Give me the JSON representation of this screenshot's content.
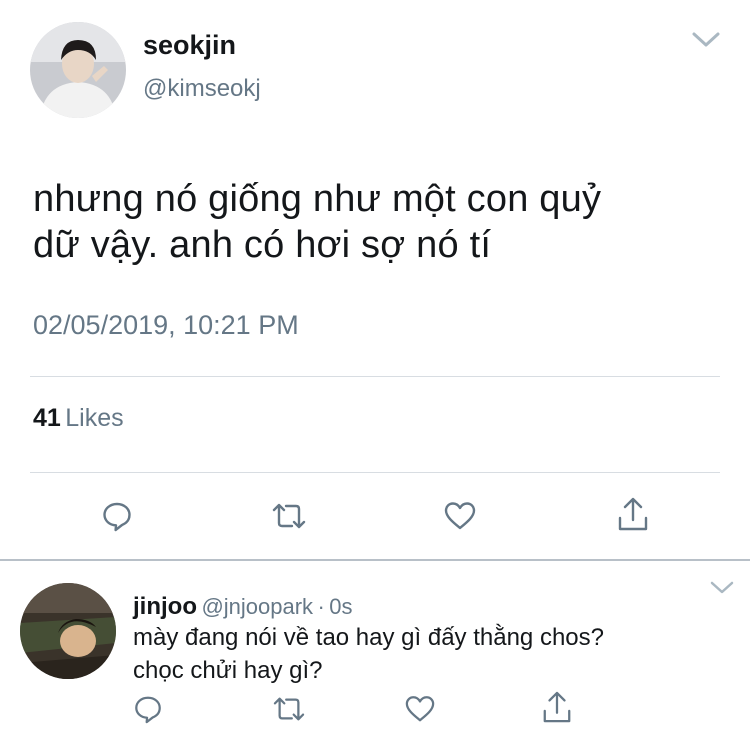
{
  "tweet": {
    "author_name": "seokjin",
    "author_handle": "@kimseokj",
    "text_line1": "nhưng nó giống như một con quỷ",
    "text_line2": "dữ vậy. anh có hơi sợ nó tí",
    "timestamp": "02/05/2019, 10:21 PM",
    "likes_count": "41",
    "likes_label": "Likes"
  },
  "reply": {
    "author_name": "jinjoo",
    "author_handle": "@jnjoopark",
    "separator": "·",
    "time": "0s",
    "text_line1": "mày đang nói về tao hay gì đấy thằng chos?",
    "text_line2": "chọc chửi hay gì?"
  },
  "icons": {
    "menu": "chevron-down-icon",
    "reply": "reply-icon",
    "retweet": "retweet-icon",
    "like": "heart-icon",
    "share": "share-icon"
  },
  "colors": {
    "text": "#14171a",
    "secondary": "#657786",
    "icon": "#657786",
    "divider": "#d8dde2"
  }
}
